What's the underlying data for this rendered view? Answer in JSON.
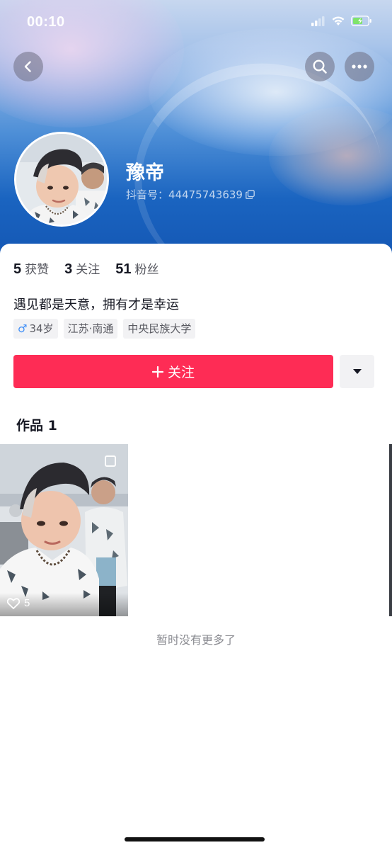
{
  "status_bar": {
    "time": "00:10"
  },
  "profile": {
    "name": "豫帝",
    "douyin_id": "抖音号：44475743639",
    "bio": "遇见都是天意，拥有才是幸运",
    "tags": [
      {
        "icon": "male-icon",
        "label": "34岁"
      },
      {
        "label": "江苏·南通"
      },
      {
        "label": "中央民族大学"
      }
    ]
  },
  "stats": [
    {
      "num": "5",
      "label": "获赞"
    },
    {
      "num": "3",
      "label": "关注"
    },
    {
      "num": "51",
      "label": "粉丝"
    }
  ],
  "actions": {
    "follow_label": "关注",
    "follow_icon": "plus-icon"
  },
  "works": {
    "tab_label": "作品 1",
    "items": [
      {
        "likes": "5"
      }
    ],
    "end_text": "暂时没有更多了"
  },
  "colors": {
    "accent": "#fe2c55",
    "banner_blue": "#1a64c0"
  }
}
